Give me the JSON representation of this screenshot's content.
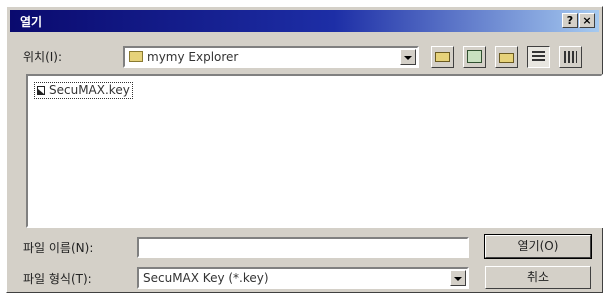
{
  "window": {
    "title": "열기",
    "help_label": "?",
    "close_label": "×"
  },
  "location": {
    "label": "위치(I):",
    "value": "mymy Explorer"
  },
  "toolbar": {
    "icons": [
      "up-folder-icon",
      "desktop-icon",
      "new-folder-icon",
      "list-view-icon",
      "details-view-icon"
    ]
  },
  "files": [
    {
      "name": "SecuMAX.key",
      "icon": "file-icon"
    }
  ],
  "filename": {
    "label": "파일 이름(N):",
    "value": ""
  },
  "filetype": {
    "label": "파일 형식(T):",
    "value": "SecuMAX Key (*.key)"
  },
  "buttons": {
    "open": "열기(O)",
    "cancel": "취소"
  },
  "colors": {
    "title_gradient_start": "#0a0a6e",
    "title_gradient_end": "#a6caf0",
    "dialog_face": "#d4d0c8"
  }
}
